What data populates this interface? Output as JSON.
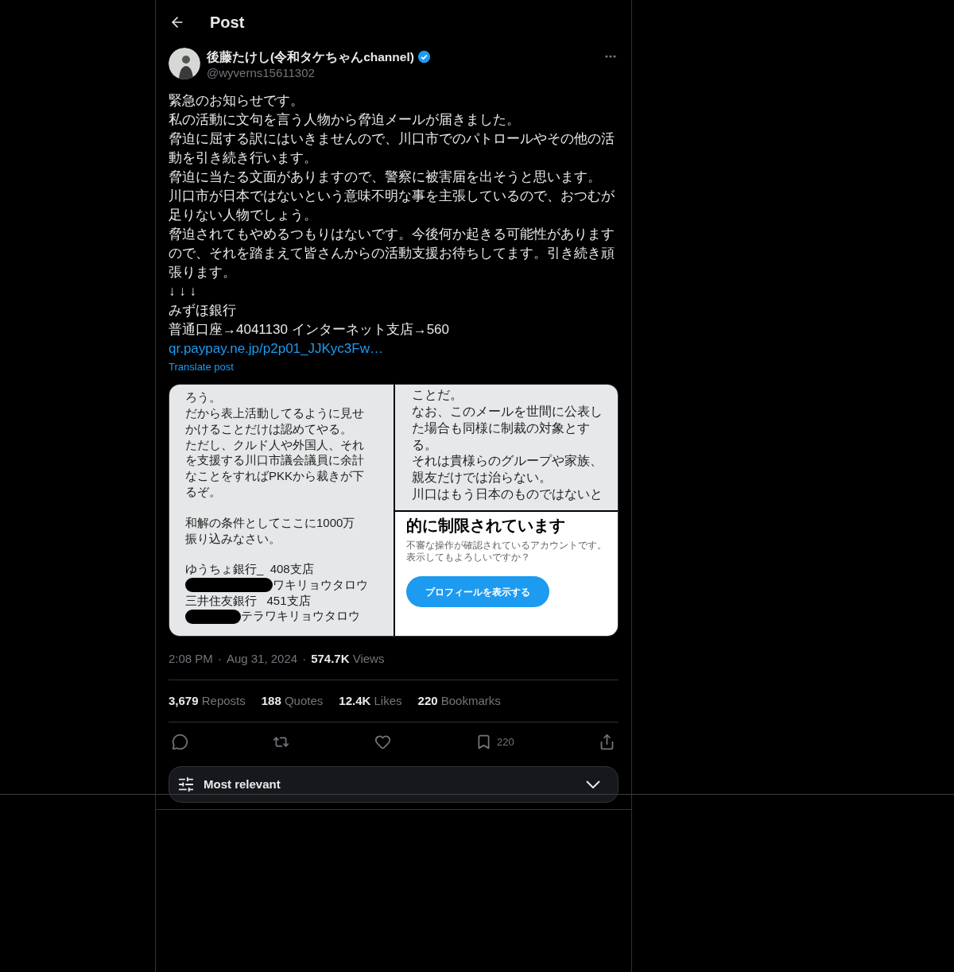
{
  "header": {
    "title": "Post"
  },
  "author": {
    "name": "後藤たけし(令和タケちゃんchannel)",
    "verified": true,
    "handle": "@wyverns15611302"
  },
  "body": {
    "paragraphs": [
      "緊急のお知らせです。",
      "私の活動に文句を言う人物から脅迫メールが届きました。",
      "脅迫に屈する訳にはいきませんので、川口市でのパトロールやその他の活動を引き続き行います。",
      "脅迫に当たる文面がありますので、警察に被害届を出そうと思います。",
      "川口市が日本ではないという意味不明な事を主張しているので、おつむが足りない人物でしょう。",
      "脅迫されてもやめるつもりはないです。今後何か起きる可能性がありますので、それを踏まえて皆さんからの活動支援お待ちしてます。引き続き頑張ります。",
      "↓ ↓ ↓",
      "みずほ銀行",
      "普通口座→4041130 インターネット支店→560"
    ],
    "link": "qr.paypay.ne.jp/p2p01_JJKyc3Fw…",
    "translate": "Translate post"
  },
  "media": {
    "left": {
      "blocks": [
        [
          "ろう。",
          "だから表上活動してるように見せ",
          "かけることだけは認めてやる。",
          "ただし、クルド人や外国人、それ",
          "を支援する川口市議会議員に余計",
          "なことをすればPKKから裁きが下",
          "るぞ。"
        ],
        [
          "和解の条件としてここに1000万",
          "振り込みなさい。"
        ]
      ],
      "accounts": [
        {
          "text": "ゆうちょ銀行_  408支店",
          "redacted": false
        },
        {
          "text": "ワキリョウタロウ",
          "redacted": true
        },
        {
          "text": "三井住友銀行   451支店",
          "redacted": false
        },
        {
          "text": "テラワキリョウタロウ",
          "redacted": true
        }
      ]
    },
    "right_top": {
      "lines": [
        "ことだ。",
        "なお、このメールを世間に公表し",
        "た場合も同様に制裁の対象とす",
        "る。",
        "それは貴様らのグループや家族、",
        "親友だけでは治らない。",
        "川口はもう日本のものではないと"
      ]
    },
    "right_bottom": {
      "title": "的に制限されています",
      "note": "不審な操作が確認されているアカウントです。表示してもよろしいですか？",
      "button": "プロフィールを表示する"
    }
  },
  "meta": {
    "separator": "·",
    "time": "2:08 PM",
    "date": "Aug 31, 2024",
    "views_count": "574.7K",
    "views_label": "Views"
  },
  "stats": [
    {
      "count": "3,679",
      "label": "Reposts"
    },
    {
      "count": "188",
      "label": "Quotes"
    },
    {
      "count": "12.4K",
      "label": "Likes"
    },
    {
      "count": "220",
      "label": "Bookmarks"
    }
  ],
  "actions": [
    {
      "kind": "reply"
    },
    {
      "kind": "repost"
    },
    {
      "kind": "like"
    },
    {
      "kind": "bookmark",
      "count": "220"
    },
    {
      "kind": "share"
    }
  ],
  "sort": {
    "label": "Most relevant"
  }
}
